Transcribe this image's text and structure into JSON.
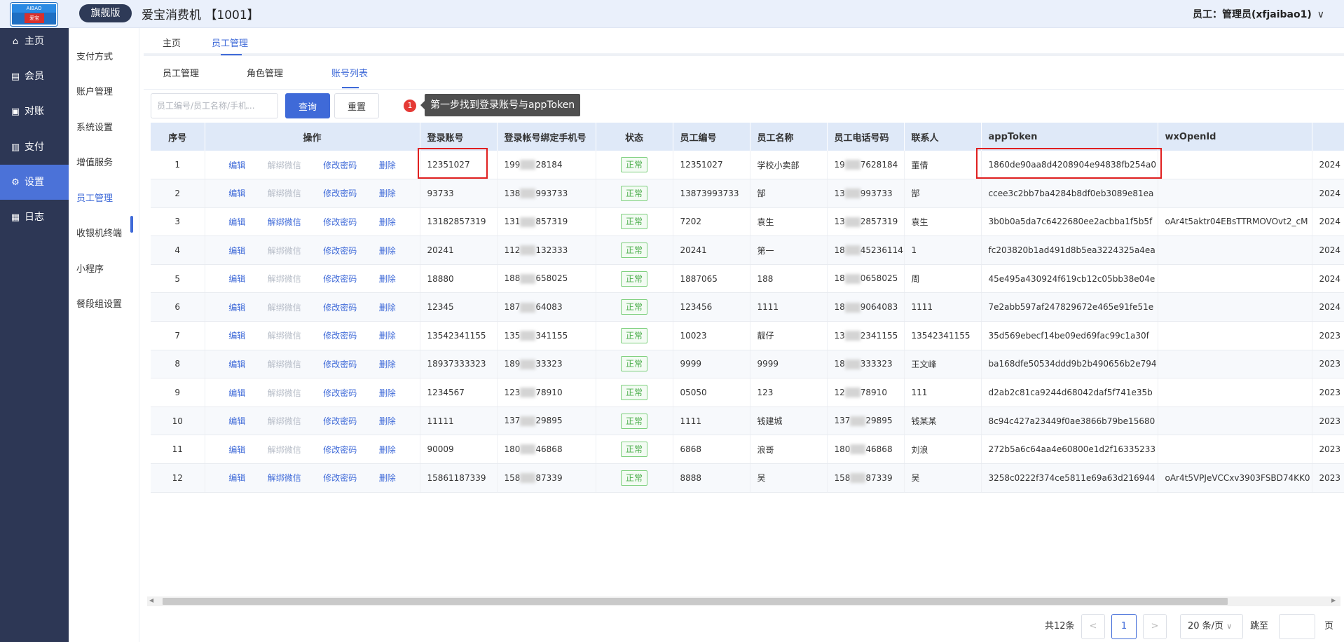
{
  "header": {
    "logo_top": "AIBAO",
    "logo_mid": "爱宝",
    "edition": "旗舰版",
    "title": "爱宝消费机 【1001】",
    "user": "员工：管理员(xfjaibao1)",
    "user_caret": "∨"
  },
  "leftnav": [
    {
      "label": "主页",
      "icon": "home-icon",
      "glyph": "⌂"
    },
    {
      "label": "会员",
      "icon": "member-icon",
      "glyph": "▤"
    },
    {
      "label": "对账",
      "icon": "reconcile-icon",
      "glyph": "▣"
    },
    {
      "label": "支付",
      "icon": "payment-icon",
      "glyph": "▥"
    },
    {
      "label": "设置",
      "icon": "gear-icon",
      "glyph": "⚙"
    },
    {
      "label": "日志",
      "icon": "log-icon",
      "glyph": "▦"
    }
  ],
  "submenu": [
    "支付方式",
    "账户管理",
    "系统设置",
    "增值服务",
    "员工管理",
    "收银机终端",
    "小程序",
    "餐段组设置"
  ],
  "tabs1": [
    "主页",
    "员工管理"
  ],
  "tabs2": [
    "员工管理",
    "角色管理",
    "账号列表"
  ],
  "search": {
    "placeholder": "员工编号/员工名称/手机...",
    "query": "查询",
    "reset": "重置"
  },
  "tooltip": {
    "step": "1",
    "text": "第一步找到登录账号与appToken"
  },
  "table": {
    "headers": [
      "序号",
      "操作",
      "登录账号",
      "登录帐号绑定手机号",
      "状态",
      "员工编号",
      "员工名称",
      "员工电话号码",
      "联系人",
      "appToken",
      "wxOpenId"
    ],
    "ops": {
      "edit": "编辑",
      "unbind": "解绑微信",
      "change_pwd": "修改密码",
      "delete": "删除"
    },
    "status": "正常",
    "rows": [
      {
        "no": "1",
        "login": "12351027",
        "phone_a": "199",
        "phone_b": "28184",
        "empno": "12351027",
        "name": "学校小卖部",
        "tel_a": "19",
        "tel_b": "7628184",
        "contact": "董倩",
        "token": "1860de90aa8d4208904e94838fb254a0",
        "openid": "",
        "date": "2024",
        "unbind_enabled": false
      },
      {
        "no": "2",
        "login": "93733",
        "phone_a": "138",
        "phone_b": "993733",
        "empno": "13873993733",
        "name": "郜",
        "tel_a": "13",
        "tel_b": "993733",
        "contact": "郜",
        "token": "ccee3c2bb7ba4284b8df0eb3089e81ea",
        "openid": "",
        "date": "2024",
        "unbind_enabled": false
      },
      {
        "no": "3",
        "login": "13182857319",
        "phone_a": "131",
        "phone_b": "857319",
        "empno": "7202",
        "name": "袁生",
        "tel_a": "13",
        "tel_b": "2857319",
        "contact": "袁生",
        "token": "3b0b0a5da7c6422680ee2acbba1f5b5f",
        "openid": "oAr4t5aktr04EBsTTRMOVOvt2_cM",
        "date": "2024",
        "unbind_enabled": true
      },
      {
        "no": "4",
        "login": "20241",
        "phone_a": "112",
        "phone_b": "132333",
        "empno": "20241",
        "name": "第一",
        "tel_a": "18",
        "tel_b": "45236114",
        "contact": "1",
        "token": "fc203820b1ad491d8b5ea3224325a4ea",
        "openid": "",
        "date": "2024",
        "unbind_enabled": false
      },
      {
        "no": "5",
        "login": "18880",
        "phone_a": "188",
        "phone_b": "658025",
        "empno": "1887065",
        "name": "188",
        "tel_a": "18",
        "tel_b": "0658025",
        "contact": "周",
        "token": "45e495a430924f619cb12c05bb38e04e",
        "openid": "",
        "date": "2024",
        "unbind_enabled": false
      },
      {
        "no": "6",
        "login": "12345",
        "phone_a": "187",
        "phone_b": "64083",
        "empno": "123456",
        "name": "1111",
        "tel_a": "18",
        "tel_b": "9064083",
        "contact": "1111",
        "token": "7e2abb597af247829672e465e91fe51e",
        "openid": "",
        "date": "2024",
        "unbind_enabled": false
      },
      {
        "no": "7",
        "login": "13542341155",
        "phone_a": "135",
        "phone_b": "341155",
        "empno": "10023",
        "name": "靓仔",
        "tel_a": "13",
        "tel_b": "2341155",
        "contact": "13542341155",
        "token": "35d569ebecf14be09ed69fac99c1a30f",
        "openid": "",
        "date": "2023",
        "unbind_enabled": false
      },
      {
        "no": "8",
        "login": "18937333323",
        "phone_a": "189",
        "phone_b": "33323",
        "empno": "9999",
        "name": "9999",
        "tel_a": "18",
        "tel_b": "333323",
        "contact": "王文峰",
        "token": "ba168dfe50534ddd9b2b490656b2e794",
        "openid": "",
        "date": "2023",
        "unbind_enabled": false
      },
      {
        "no": "9",
        "login": "1234567",
        "phone_a": "123",
        "phone_b": "78910",
        "empno": "05050",
        "name": "123",
        "tel_a": "12",
        "tel_b": "78910",
        "contact": "111",
        "token": "d2ab2c81ca9244d68042daf5f741e35b",
        "openid": "",
        "date": "2023",
        "unbind_enabled": false
      },
      {
        "no": "10",
        "login": "11111",
        "phone_a": "137",
        "phone_b": "29895",
        "empno": "1111",
        "name": "钱建城",
        "tel_a": "137",
        "tel_b": "29895",
        "contact": "钱某某",
        "token": "8c94c427a23449f0ae3866b79be15680",
        "openid": "",
        "date": "2023",
        "unbind_enabled": false
      },
      {
        "no": "11",
        "login": "90009",
        "phone_a": "180",
        "phone_b": "46868",
        "empno": "6868",
        "name": "浪哥",
        "tel_a": "180",
        "tel_b": "46868",
        "contact": "刘浪",
        "token": "272b5a6c64aa4e60800e1d2f16335233",
        "openid": "",
        "date": "2023",
        "unbind_enabled": false
      },
      {
        "no": "12",
        "login": "15861187339",
        "phone_a": "158",
        "phone_b": "87339",
        "empno": "8888",
        "name": "吴",
        "tel_a": "158",
        "tel_b": "87339",
        "contact": "吴",
        "token": "3258c0222f374ce5811e69a63d216944",
        "openid": "oAr4t5VPJeVCCxv3903FSBD74KK0",
        "date": "2023",
        "unbind_enabled": true
      }
    ]
  },
  "pagination": {
    "total": "共12条",
    "prev": "<",
    "page": "1",
    "next": ">",
    "size": "20 条/页",
    "size_caret": "∨",
    "goto": "跳至",
    "unit": "页"
  }
}
